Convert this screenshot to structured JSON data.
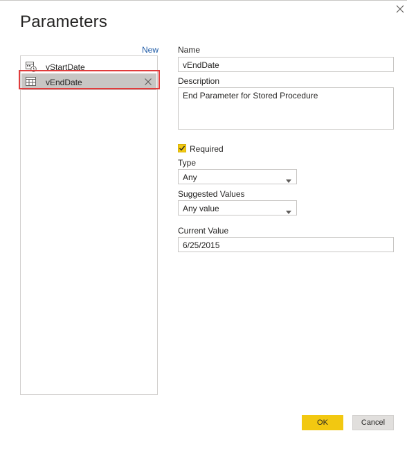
{
  "dialog": {
    "title": "Parameters",
    "new_link": "New"
  },
  "parameters_list": [
    {
      "label": "vStartDate",
      "icon": "parameter-calendar-clock-icon",
      "selected": false
    },
    {
      "label": "vEndDate",
      "icon": "parameter-table-icon",
      "selected": true
    }
  ],
  "form": {
    "name_label": "Name",
    "name_value": "vEndDate",
    "description_label": "Description",
    "description_value": "End Parameter for Stored Procedure",
    "required_label": "Required",
    "required_checked": true,
    "type_label": "Type",
    "type_value": "Any",
    "suggested_label": "Suggested Values",
    "suggested_value": "Any value",
    "current_label": "Current Value",
    "current_value": "6/25/2015"
  },
  "buttons": {
    "ok": "OK",
    "cancel": "Cancel"
  },
  "colors": {
    "accent": "#f2c811",
    "highlight_border": "#e03c3c",
    "link": "#1f5ba6",
    "selected_row": "#c8c6c4"
  }
}
